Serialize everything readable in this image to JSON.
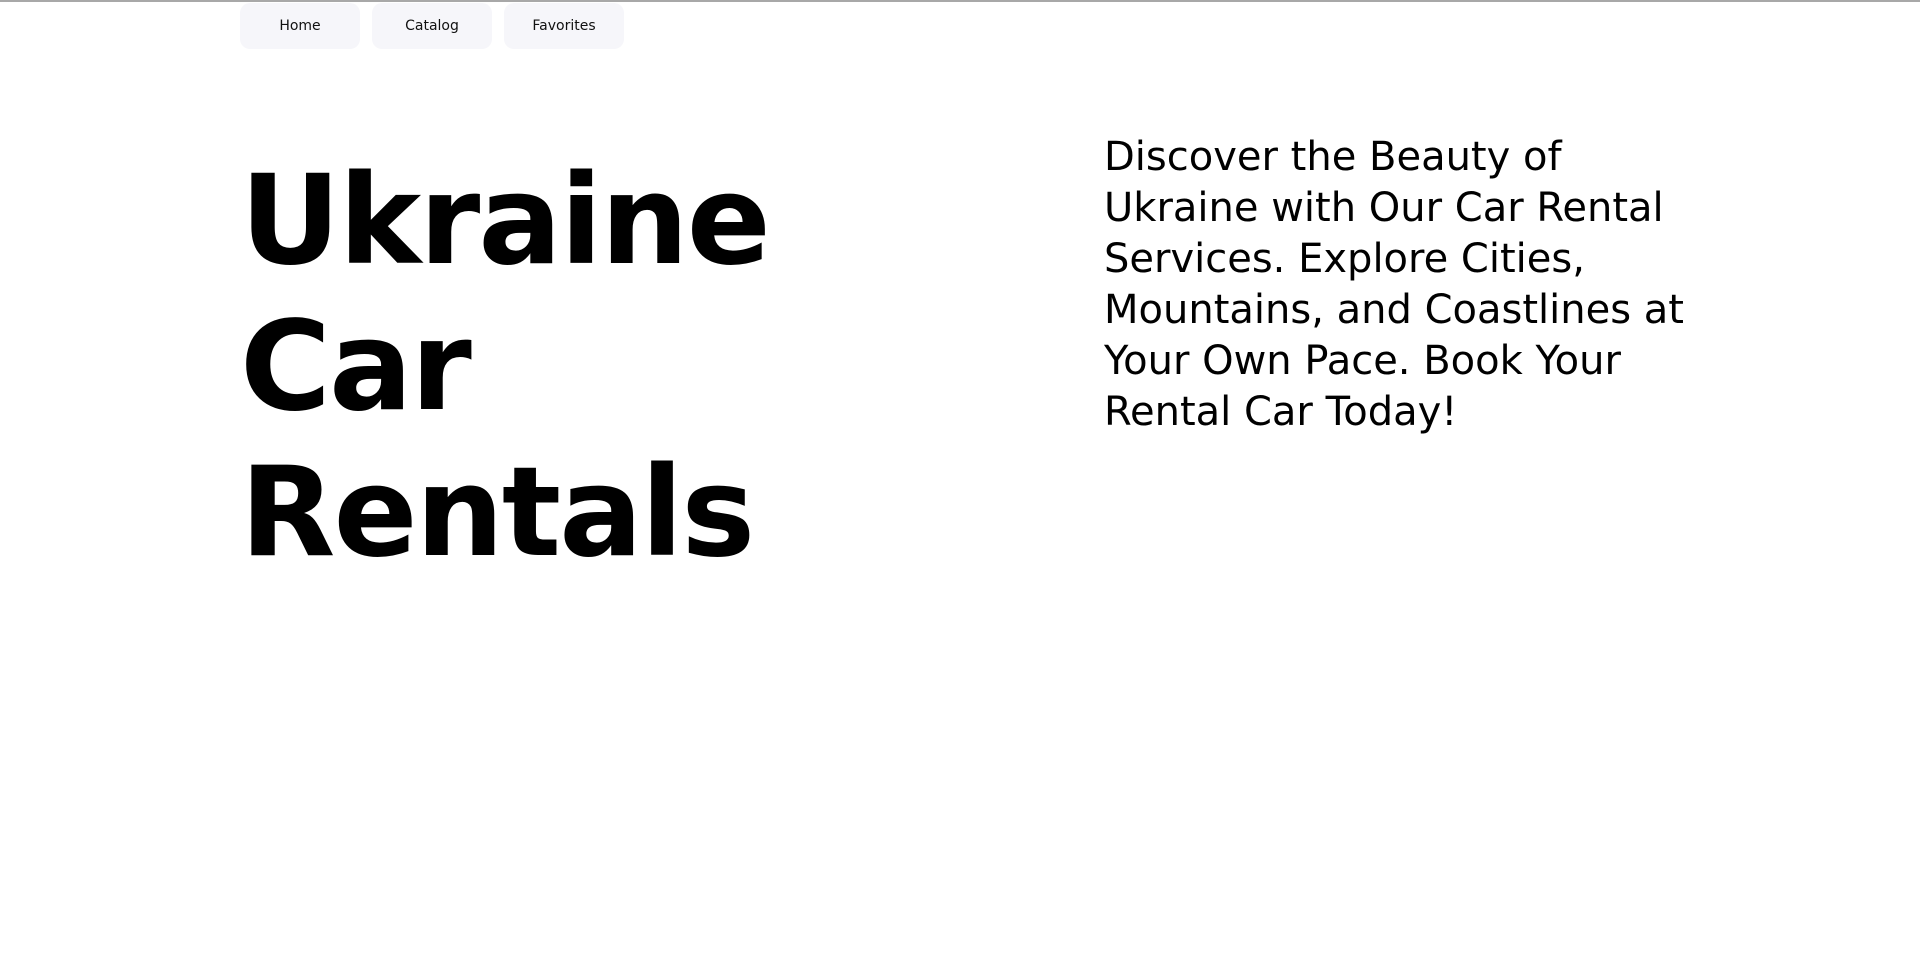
{
  "nav": {
    "items": [
      {
        "label": "Home"
      },
      {
        "label": "Catalog"
      },
      {
        "label": "Favorites"
      }
    ]
  },
  "hero": {
    "title": "Ukraine Car Rentals",
    "description": "Discover the Beauty of Ukraine with Our Car Rental Services. Explore Cities, Mountains, and Coastlines at Your Own Pace. Book Your Rental Car Today!"
  },
  "colors": {
    "background": "#ffffff",
    "nav_button_bg": "#f6f6fa",
    "text": "#000000",
    "top_border": "#a8a8a8"
  }
}
